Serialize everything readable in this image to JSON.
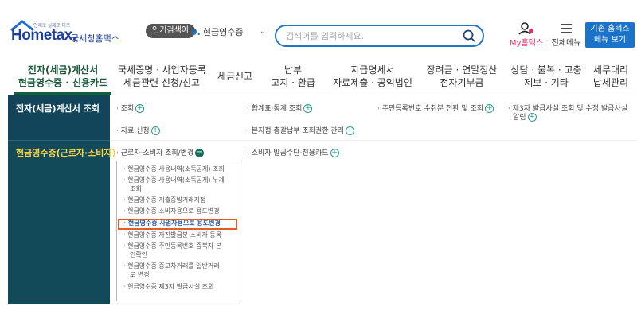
{
  "header": {
    "logo_slogan": "언제로 실제로 미로",
    "logo_brand": "Hometax,",
    "logo_brand_ko": "국세청홈택스",
    "popular_badge": "인기검색어",
    "popular_select": {
      "rank": "9.",
      "value": "현금영수증"
    },
    "search_placeholder": "검색어를 입력하세요.",
    "my_label": "My홈택스",
    "allmenu_label": "전체메뉴",
    "basic_view_line1": "기존 홈택스",
    "basic_view_line2": "메뉴 보기"
  },
  "nav": {
    "items": [
      {
        "line1": "전자(세금)계산서",
        "line2": "현금영수증 · 신용카드"
      },
      {
        "line1": "국세증명 · 사업자등록",
        "line2": "세금관련 신청/신고"
      },
      {
        "line1": "세금신고",
        "line2": ""
      },
      {
        "line1": "납부",
        "line2": "고지 · 환급"
      },
      {
        "line1": "지급명세서",
        "line2": "자료제출 · 공익법인"
      },
      {
        "line1": "장려금 · 연말정산",
        "line2": "전자기부금"
      },
      {
        "line1": "상담 · 불복 · 고충",
        "line2": "제보 · 기타"
      },
      {
        "line1": "세무대리",
        "line2": "납세관리"
      }
    ]
  },
  "section1": {
    "title": "전자(세금)계산서 조회",
    "links": [
      "· 조회",
      "· 합계표·통계 조회",
      "· 주민등록번호 수취분 전환 및 조회",
      "· 제3자 발급사실 조회 및 수정 발급사실",
      "알림",
      "· 자료 신청",
      "· 본지점·총괄납부 조회권한 관리"
    ]
  },
  "section2": {
    "title": "현금영수증(근로자·소비자)",
    "links": [
      "· 근로자·소비자 조회/변경",
      "· 소비자 발급수단·전용카드"
    ],
    "dropdown": [
      "· 현금영수증 사용내역(소득공제) 조회",
      "· 현금영수증 사용내역(소득공제) 누계",
      "조회",
      "· 현금영수증 지출증빙거래지정",
      "· 현금영수증 소비자용으로 용도변경",
      "· 현금영수증 사업자용으로 용도변경",
      "· 현금영수증 자진발급분 소비자 등록",
      "· 현금영수증 주민등록번호 중복자 본",
      "인확인",
      "· 현금영수증 중고차거래를 일반거래",
      "로 변경",
      "· 현금영수증 제3자 발급사실 조회"
    ]
  },
  "colors": {
    "accent": "#1a73c9",
    "sidebar": "#124a5a",
    "highlight": "#e55a2b",
    "active_nav": "#145e3c"
  }
}
